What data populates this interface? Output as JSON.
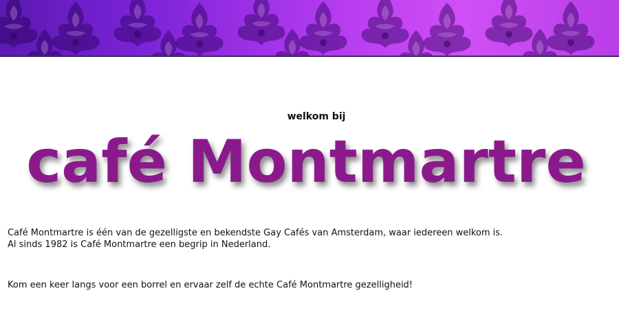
{
  "banner": {
    "pattern": "damask-pattern",
    "colors": {
      "left": "#5a1ab0",
      "middle": "#b63cf0",
      "right": "#d050f5",
      "border": "#3a2a55"
    }
  },
  "hero": {
    "welcome": "welkom bij",
    "title": "café Montmartre",
    "title_color": "#8a1a8c"
  },
  "content": {
    "line1": "Café Montmartre is één van de gezelligste en bekendste Gay Cafés van Amsterdam, waar iedereen welkom is.",
    "line2": "Al sinds 1982 is Café Montmartre een begrip in Nederland.",
    "invite": "Kom een keer langs voor een borrel en ervaar zelf de echte Café Montmartre gezelligheid!"
  }
}
